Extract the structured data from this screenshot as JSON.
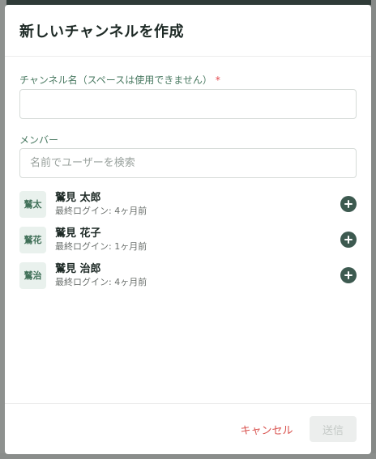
{
  "modal": {
    "title": "新しいチャンネルを作成"
  },
  "channel_name": {
    "label": "チャンネル名（スペースは使用できません）",
    "required_mark": "*",
    "value": "",
    "placeholder": ""
  },
  "members": {
    "label": "メンバー",
    "search_placeholder": "名前でユーザーを検索",
    "list": [
      {
        "avatar": "鷲太",
        "name": "鷲見 太郎",
        "status": "最終ログイン: 4ヶ月前"
      },
      {
        "avatar": "鷲花",
        "name": "鷲見 花子",
        "status": "最終ログイン: 1ヶ月前"
      },
      {
        "avatar": "鷲治",
        "name": "鷲見 治郎",
        "status": "最終ログイン: 4ヶ月前"
      }
    ]
  },
  "footer": {
    "cancel_label": "キャンセル",
    "submit_label": "送信"
  },
  "colors": {
    "accent": "#3d5a50",
    "cancel": "#d9534f",
    "label": "#4a7a62"
  },
  "icons": {
    "add": "plus-circle-icon"
  }
}
